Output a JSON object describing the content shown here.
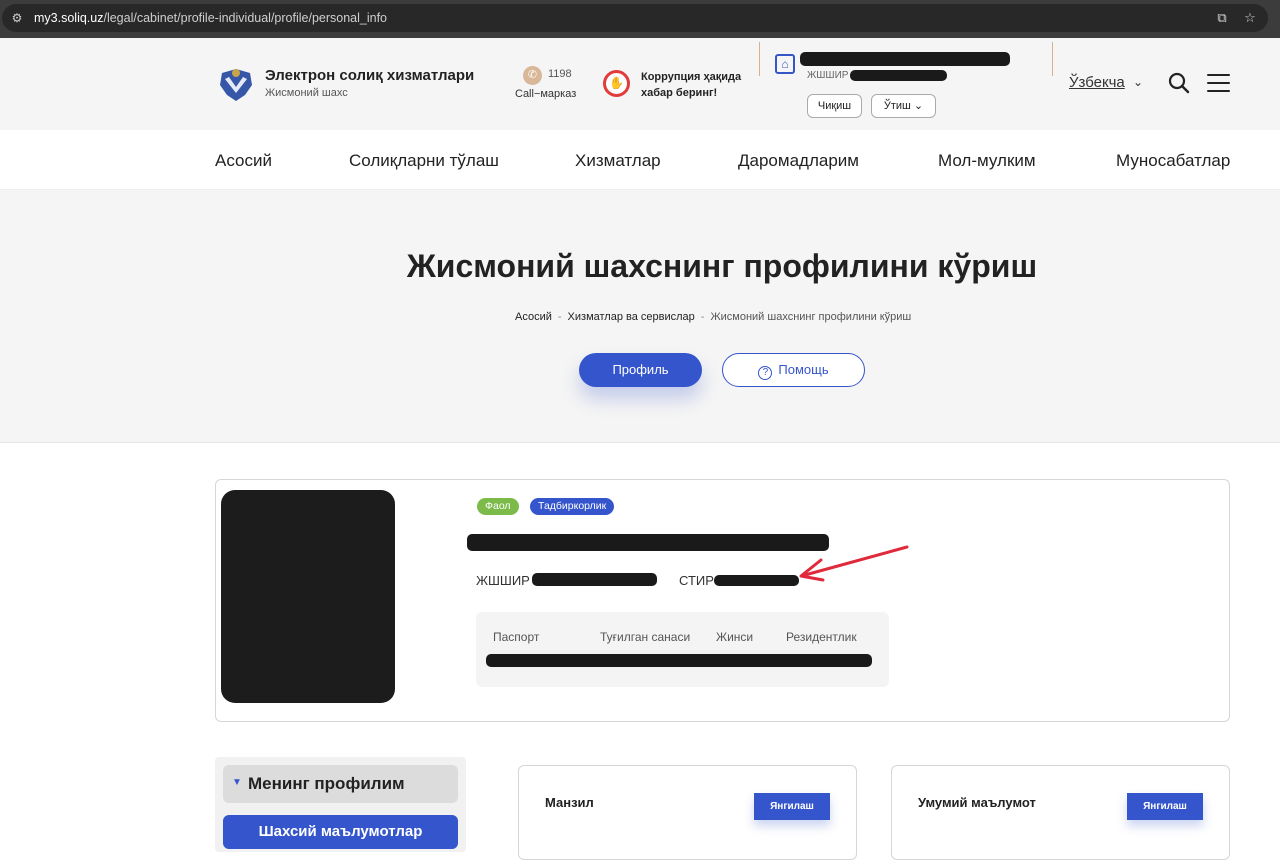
{
  "browser": {
    "url_host": "my3.soliq.uz",
    "url_path": "/legal/cabinet/profile-individual/profile/personal_info"
  },
  "header": {
    "brand_title": "Электрон солиқ хизматлари",
    "brand_subtitle": "Жисмоний шахс",
    "call_number": "1198",
    "call_label": "Call−марказ",
    "corruption_line1": "Коррупция ҳақида",
    "corruption_line2": "хабар беринг!",
    "user_jshshir_label": "ЖШШИР",
    "logout_label": "Чиқиш",
    "switch_label": "Ўтиш",
    "language": "Ўзбекча"
  },
  "nav": {
    "items": [
      "Асосий",
      "Солиқларни тўлаш",
      "Хизматлар",
      "Даромадларим",
      "Мол-мулким",
      "Муносабатлар"
    ]
  },
  "hero": {
    "title": "Жисмоний шахснинг профилини кўриш",
    "breadcrumbs": [
      "Асосий",
      "Хизматлар ва сервислар",
      "Жисмоний шахснинг профилини кўриш"
    ],
    "profile_button": "Профиль",
    "help_button": "Помощь"
  },
  "profile": {
    "badges": [
      "Фаол",
      "Тадбиркорлик"
    ],
    "badge_colors": [
      "#7cbb4a",
      "#3555cc"
    ],
    "jshshir_label": "ЖШШИР",
    "stir_label": "СТИР",
    "info_headers": [
      "Паспорт",
      "Туғилган санаси",
      "Жинси",
      "Резидентлик"
    ]
  },
  "sidebar": {
    "heading": "Менинг профилим",
    "active_item": "Шахсий маълумотлар"
  },
  "cards": [
    {
      "title": "Манзил",
      "button": "Янгилаш"
    },
    {
      "title": "Умумий маълумот",
      "button": "Янгилаш"
    }
  ],
  "colors": {
    "accent": "#3555cc",
    "danger": "#e23b3b",
    "annotation_arrow": "#e02a3c"
  }
}
